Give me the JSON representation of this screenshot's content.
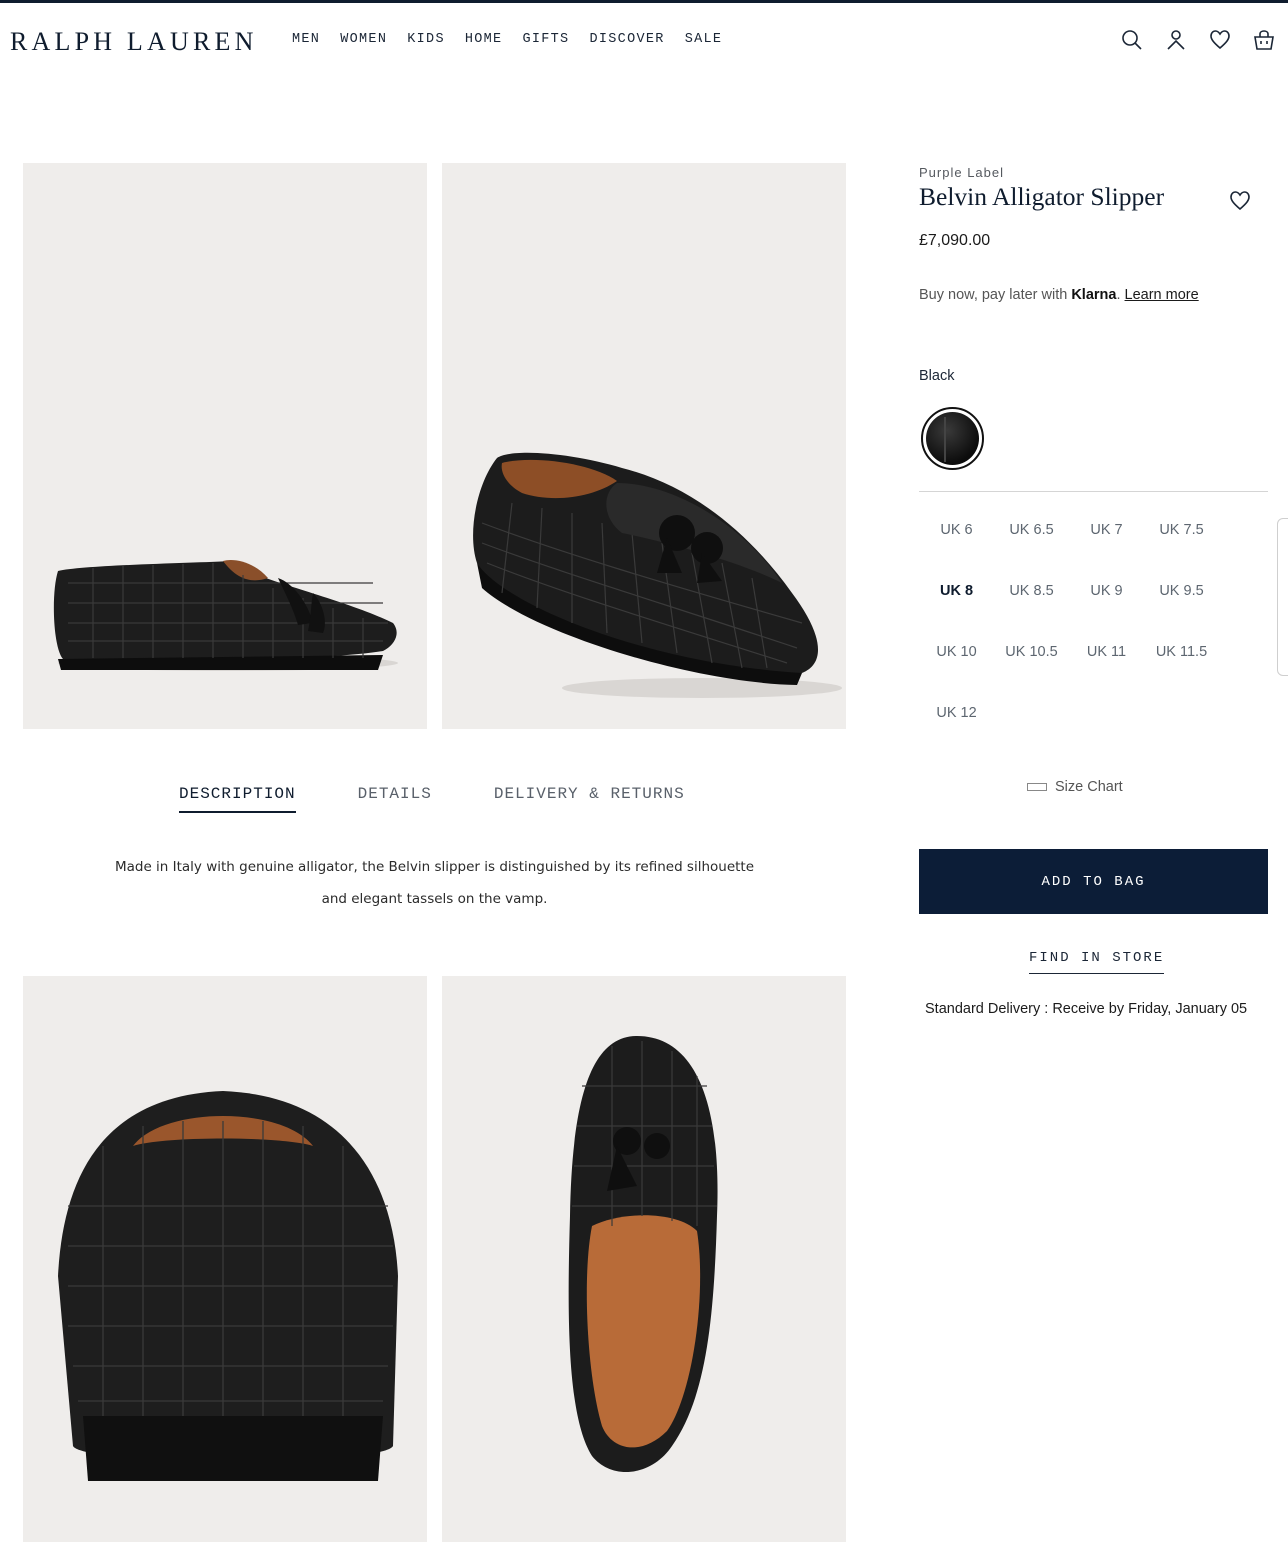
{
  "header": {
    "logo": "RALPH LAUREN",
    "nav": [
      "MEN",
      "WOMEN",
      "KIDS",
      "HOME",
      "GIFTS",
      "DISCOVER",
      "SALE"
    ],
    "icons": [
      "search-icon",
      "account-icon",
      "wishlist-icon",
      "bag-icon"
    ]
  },
  "product": {
    "brand": "Purple Label",
    "title": "Belvin Alligator Slipper",
    "price": "£7,090.00",
    "klarna": {
      "prefix": "Buy now, pay later with ",
      "brand": "Klarna",
      "dot": ".",
      "link": "Learn more"
    },
    "color_label": "Black",
    "sizes": [
      "UK 6",
      "UK 6.5",
      "UK 7",
      "UK 7.5",
      "UK 8",
      "UK 8.5",
      "UK 9",
      "UK 9.5",
      "UK 10",
      "UK 10.5",
      "UK 11",
      "UK 11.5",
      "UK 12"
    ],
    "selected_size": "UK 8",
    "size_chart": "Size Chart",
    "add_to_bag": "ADD TO BAG",
    "find_in_store": "FIND IN STORE",
    "delivery": "Standard Delivery : Receive by Friday, January 05"
  },
  "tabs": [
    "DESCRIPTION",
    "DETAILS",
    "DELIVERY & RETURNS"
  ],
  "active_tab": "DESCRIPTION",
  "description": {
    "line1": "Made in Italy with genuine alligator, the Belvin slipper is distinguished by its refined silhouette",
    "line2": "and elegant tassels on the vamp."
  },
  "colors": {
    "navy": "#0c1d37",
    "image_bg": "#efedeb"
  }
}
